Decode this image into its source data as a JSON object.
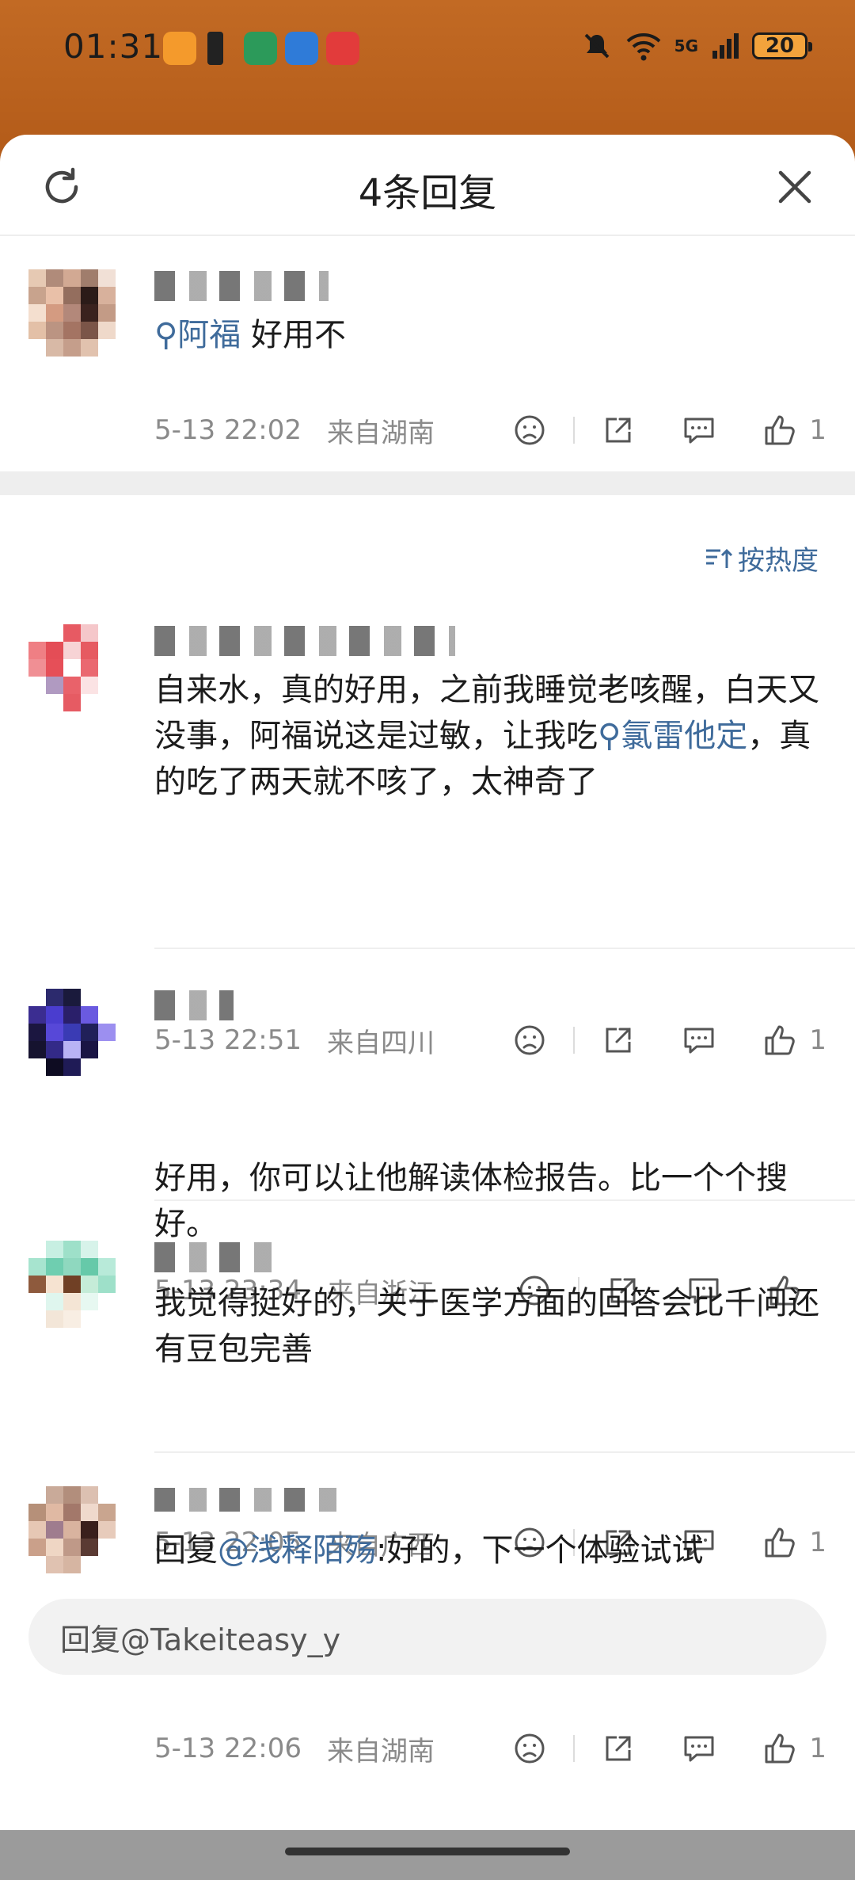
{
  "status_bar": {
    "time": "01:31",
    "network": "5G",
    "battery": "20"
  },
  "sheet": {
    "title": "4条回复",
    "sort_label": "按热度"
  },
  "original_comment": {
    "text_link": "阿福",
    "text_rest": "好用不",
    "date": "5-13 22:02",
    "location": "来自湖南",
    "likes": "1"
  },
  "replies": [
    {
      "text_before": "自来水，真的好用，之前我睡觉老咳醒，白天又没事，阿福说这是过敏，让我吃",
      "link": "氯雷他定",
      "text_after": "，真的吃了两天就不咳了，太神奇了",
      "date": "5-13 22:51",
      "location": "来自四川",
      "likes": "1"
    },
    {
      "text": "好用，你可以让他解读体检报告。比一个个搜好。",
      "date": "5-13 23:34",
      "location": "来自浙江",
      "likes": ""
    },
    {
      "text": "我觉得挺好的，关于医学方面的回答会比千问还有豆包完善",
      "date": "5-13 22:05",
      "location": "来自广西",
      "likes": "1"
    },
    {
      "prefix": "回复",
      "mention": "@浅释陌殇",
      "text": ":好的，下一个体验试试",
      "date": "5-13 22:06",
      "location": "来自湖南",
      "likes": "1"
    }
  ],
  "input": {
    "placeholder": "回复@Takeiteasy_y"
  },
  "colors": {
    "link": "#3f6b9b",
    "meta": "#8a8a8a",
    "text": "#1c1c1c"
  }
}
